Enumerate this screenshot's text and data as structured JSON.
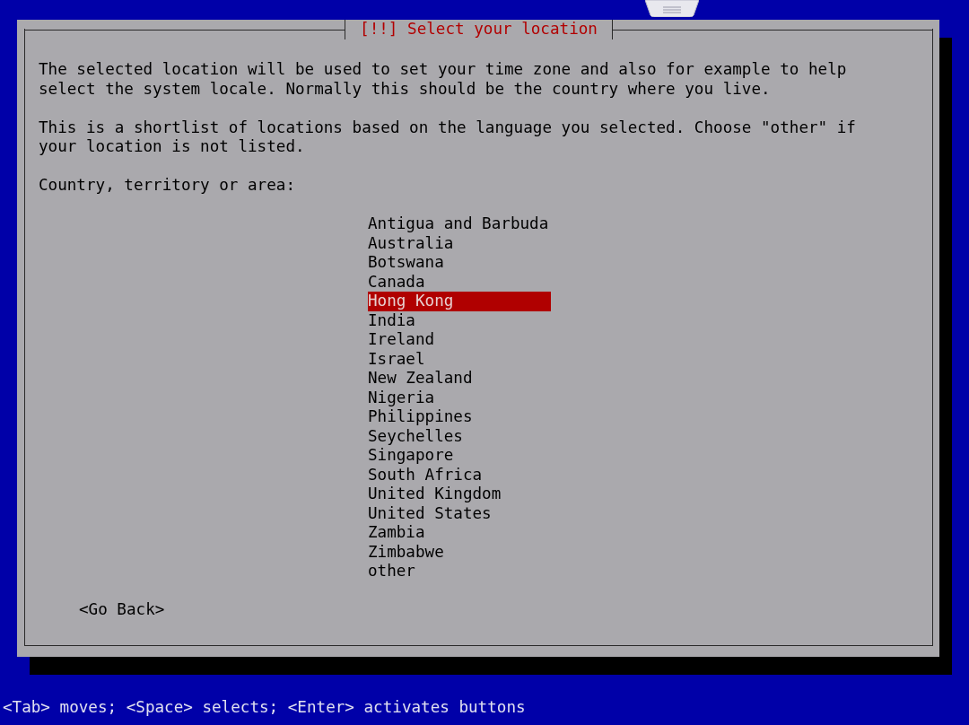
{
  "dialog": {
    "title": "[!!] Select your location",
    "paragraphs": [
      "The selected location will be used to set your time zone and also for example to help\nselect the system locale. Normally this should be the country where you live.",
      "This is a shortlist of locations based on the language you selected. Choose \"other\" if\nyour location is not listed."
    ],
    "prompt": "Country, territory or area:",
    "countries": [
      {
        "label": "Antigua and Barbuda",
        "selected": false
      },
      {
        "label": "Australia",
        "selected": false
      },
      {
        "label": "Botswana",
        "selected": false
      },
      {
        "label": "Canada",
        "selected": false
      },
      {
        "label": "Hong Kong",
        "selected": true
      },
      {
        "label": "India",
        "selected": false
      },
      {
        "label": "Ireland",
        "selected": false
      },
      {
        "label": "Israel",
        "selected": false
      },
      {
        "label": "New Zealand",
        "selected": false
      },
      {
        "label": "Nigeria",
        "selected": false
      },
      {
        "label": "Philippines",
        "selected": false
      },
      {
        "label": "Seychelles",
        "selected": false
      },
      {
        "label": "Singapore",
        "selected": false
      },
      {
        "label": "South Africa",
        "selected": false
      },
      {
        "label": "United Kingdom",
        "selected": false
      },
      {
        "label": "United States",
        "selected": false
      },
      {
        "label": "Zambia",
        "selected": false
      },
      {
        "label": "Zimbabwe",
        "selected": false
      },
      {
        "label": "other",
        "selected": false
      }
    ],
    "back_button": "<Go Back>"
  },
  "status_bar": "<Tab> moves; <Space> selects; <Enter> activates buttons"
}
